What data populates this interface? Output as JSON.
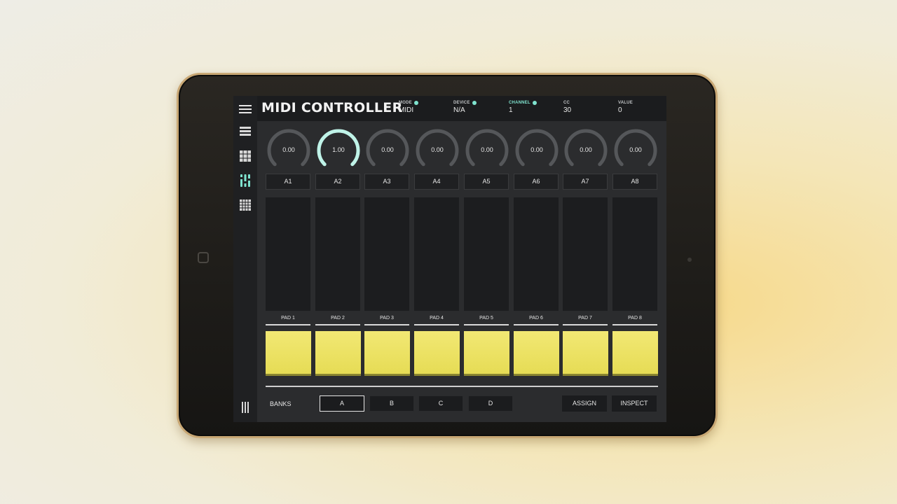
{
  "app": {
    "title": "MIDI CONTROLLER"
  },
  "status": {
    "mode": {
      "label": "MODE",
      "value": "MIDI"
    },
    "device": {
      "label": "DEVICE",
      "value": "N/A"
    },
    "channel": {
      "label": "CHANNEL",
      "value": "1"
    },
    "cc": {
      "label": "CC",
      "value": "30"
    },
    "value": {
      "label": "VALUE",
      "value": "0"
    }
  },
  "sidebar": {
    "items": [
      {
        "icon": "list-icon"
      },
      {
        "icon": "grid-icon"
      },
      {
        "icon": "mixer-icon"
      },
      {
        "icon": "keyboard-grid-icon"
      }
    ],
    "bottom_icon": "collapse-icon"
  },
  "knobs": [
    {
      "value": "0.00",
      "level": 0.0,
      "label": "A1"
    },
    {
      "value": "1.00",
      "level": 1.0,
      "label": "A2"
    },
    {
      "value": "0.00",
      "level": 0.0,
      "label": "A3"
    },
    {
      "value": "0.00",
      "level": 0.0,
      "label": "A4"
    },
    {
      "value": "0.00",
      "level": 0.0,
      "label": "A5"
    },
    {
      "value": "0.00",
      "level": 0.0,
      "label": "A6"
    },
    {
      "value": "0.00",
      "level": 0.0,
      "label": "A7"
    },
    {
      "value": "0.00",
      "level": 0.0,
      "label": "A8"
    }
  ],
  "pads": [
    {
      "label": "PAD 1"
    },
    {
      "label": "PAD 2"
    },
    {
      "label": "PAD 3"
    },
    {
      "label": "PAD 4"
    },
    {
      "label": "PAD 5"
    },
    {
      "label": "PAD 6"
    },
    {
      "label": "PAD 7"
    },
    {
      "label": "PAD 8"
    }
  ],
  "banks": {
    "label": "BANKS",
    "options": [
      "A",
      "B",
      "C",
      "D"
    ],
    "selected": "A"
  },
  "actions": {
    "assign": "ASSIGN",
    "inspect": "INSPECT"
  },
  "colors": {
    "accent": "#7fe3cf",
    "pad": "#ece25f",
    "background": "#2b2c2e"
  }
}
